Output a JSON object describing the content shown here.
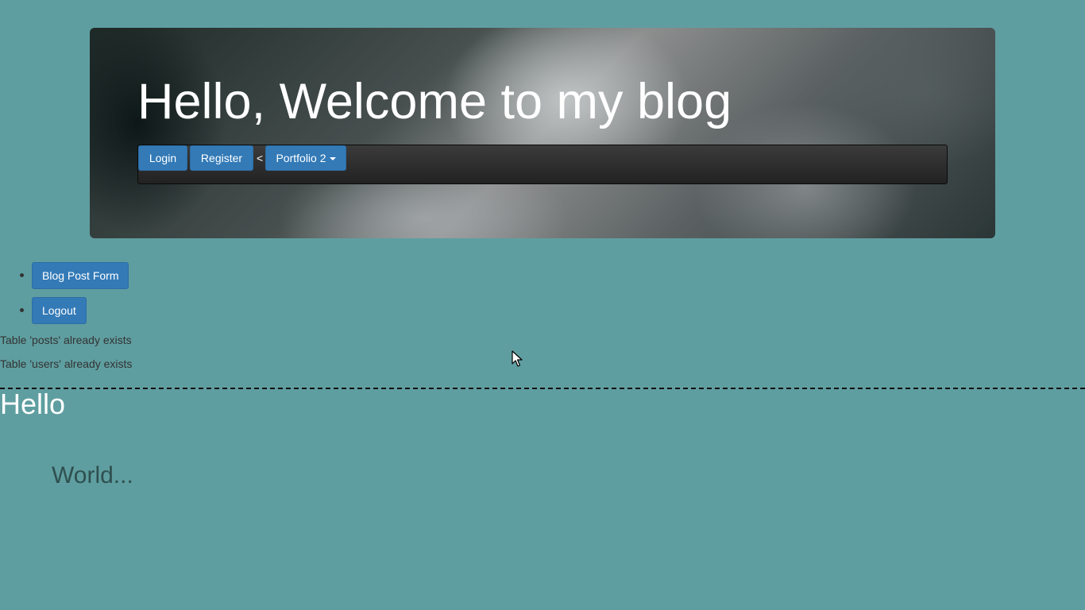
{
  "header": {
    "title": "Hello, Welcome to my blog"
  },
  "nav": {
    "login_label": "Login",
    "register_label": "Register",
    "separator": "<",
    "portfolio_label": "Portfolio 2"
  },
  "actions": [
    {
      "label": "Blog Post Form"
    },
    {
      "label": "Logout"
    }
  ],
  "messages": [
    "Table 'posts' already exists",
    "Table 'users' already exists"
  ],
  "post": {
    "title": "Hello",
    "body": "World..."
  },
  "colors": {
    "background": "#5f9ea0",
    "button": "#337ab7",
    "navbar": "#2b2b2b"
  },
  "icons": {
    "dropdown": "caret-down-icon",
    "pointer": "mouse-cursor-icon"
  }
}
